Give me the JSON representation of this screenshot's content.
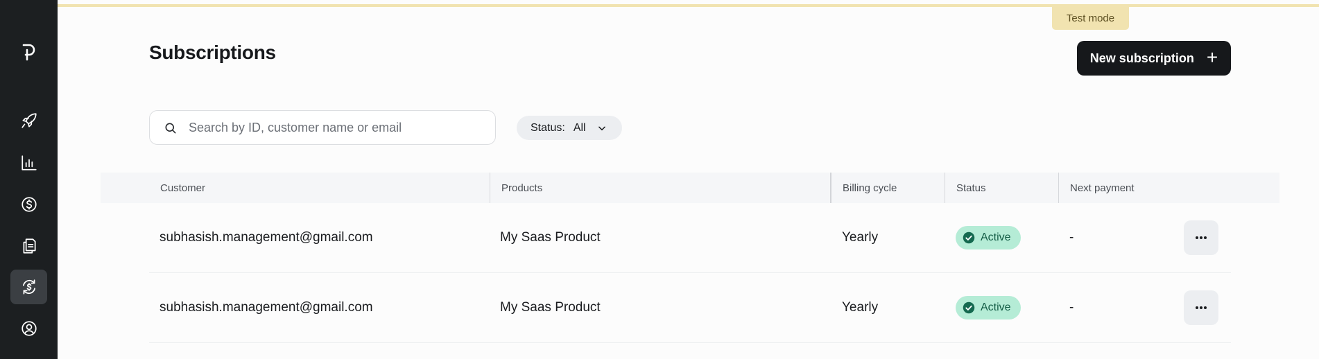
{
  "sidebar": {
    "logo": "brand-logo",
    "items": [
      {
        "icon": "rocket-icon",
        "name": "nav-get-started"
      },
      {
        "icon": "bar-chart-icon",
        "name": "nav-analytics"
      },
      {
        "icon": "dollar-circle-icon",
        "name": "nav-payments"
      },
      {
        "icon": "documents-icon",
        "name": "nav-products"
      },
      {
        "icon": "recurring-dollar-icon",
        "name": "nav-subscriptions",
        "active": true
      },
      {
        "icon": "user-circle-icon",
        "name": "nav-customers"
      }
    ]
  },
  "header": {
    "test_mode": "Test mode",
    "title": "Subscriptions",
    "new_button": "New subscription"
  },
  "search": {
    "placeholder": "Search by ID, customer name or email",
    "value": ""
  },
  "filter": {
    "label": "Status:",
    "value": "All"
  },
  "table": {
    "columns": [
      "Customer",
      "Products",
      "Billing cycle",
      "Status",
      "Next payment"
    ],
    "rows": [
      {
        "customer": "subhasish.management@gmail.com",
        "product": "My Saas Product",
        "billing_cycle": "Yearly",
        "status": "Active",
        "next_payment": "-"
      },
      {
        "customer": "subhasish.management@gmail.com",
        "product": "My Saas Product",
        "billing_cycle": "Yearly",
        "status": "Active",
        "next_payment": "-"
      }
    ]
  },
  "colors": {
    "sidebar_bg": "#1c1f21",
    "primary_button": "#16181b",
    "test_mode_bg": "#f1e3b0",
    "active_badge_bg": "#b5ecd6",
    "active_badge_icon": "#14694f"
  }
}
